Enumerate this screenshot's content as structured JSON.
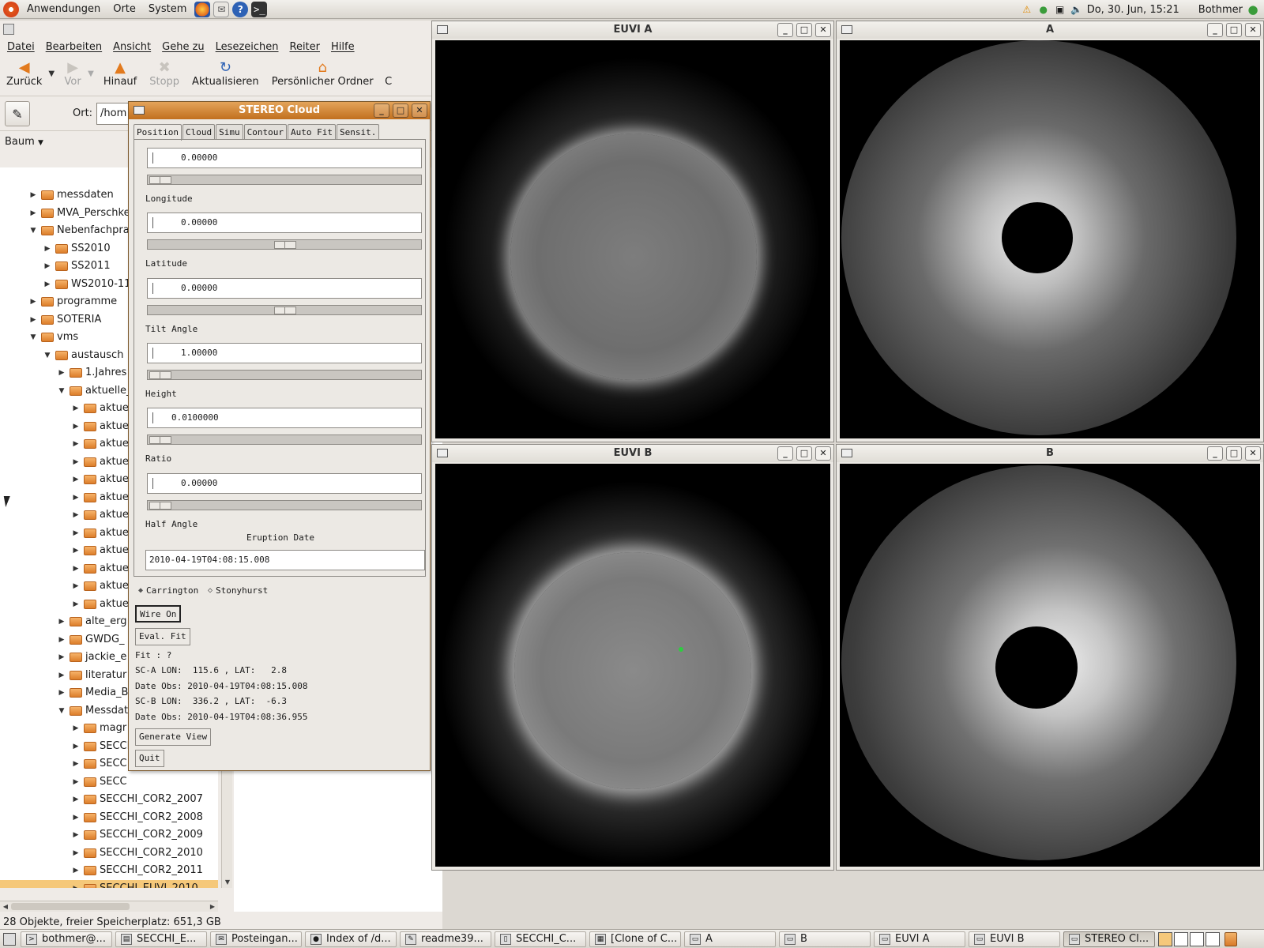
{
  "top_panel": {
    "menus": [
      "Anwendungen",
      "Orte",
      "System"
    ],
    "launchers": [
      "firefox-icon",
      "mail-icon",
      "help-icon",
      "terminal-icon"
    ],
    "clock": "Do, 30. Jun, 15:21",
    "user": "Bothmer"
  },
  "nautilus": {
    "menubar": [
      "Datei",
      "Bearbeiten",
      "Ansicht",
      "Gehe zu",
      "Lesezeichen",
      "Reiter",
      "Hilfe"
    ],
    "toolbar": {
      "back": "Zurück",
      "forward": "Vor",
      "up": "Hinauf",
      "stop": "Stopp",
      "reload": "Aktualisieren",
      "home": "Persönlicher Ordner",
      "overflow": "C"
    },
    "location_label": "Ort:",
    "location_value": "/hom",
    "sidebar_mode": "Baum",
    "tree": [
      {
        "label": "messdaten",
        "depth": 2,
        "state": "collapsed"
      },
      {
        "label": "MVA_Perschke",
        "depth": 2,
        "state": "collapsed"
      },
      {
        "label": "Nebenfachpra",
        "depth": 2,
        "state": "expanded"
      },
      {
        "label": "SS2010",
        "depth": 3,
        "state": "collapsed"
      },
      {
        "label": "SS2011",
        "depth": 3,
        "state": "collapsed"
      },
      {
        "label": "WS2010-11",
        "depth": 3,
        "state": "collapsed"
      },
      {
        "label": "programme",
        "depth": 2,
        "state": "collapsed"
      },
      {
        "label": "SOTERIA",
        "depth": 2,
        "state": "collapsed"
      },
      {
        "label": "vms",
        "depth": 2,
        "state": "expanded"
      },
      {
        "label": "austausch",
        "depth": 3,
        "state": "expanded"
      },
      {
        "label": "1.Jahres",
        "depth": 4,
        "state": "collapsed"
      },
      {
        "label": "aktuelle_",
        "depth": 4,
        "state": "expanded"
      },
      {
        "label": "aktue",
        "depth": 5,
        "state": "collapsed"
      },
      {
        "label": "aktue",
        "depth": 5,
        "state": "collapsed"
      },
      {
        "label": "aktue",
        "depth": 5,
        "state": "collapsed"
      },
      {
        "label": "aktue",
        "depth": 5,
        "state": "collapsed"
      },
      {
        "label": "aktue",
        "depth": 5,
        "state": "collapsed"
      },
      {
        "label": "aktue",
        "depth": 5,
        "state": "collapsed"
      },
      {
        "label": "aktue",
        "depth": 5,
        "state": "collapsed"
      },
      {
        "label": "aktue",
        "depth": 5,
        "state": "collapsed"
      },
      {
        "label": "aktue",
        "depth": 5,
        "state": "collapsed"
      },
      {
        "label": "aktue",
        "depth": 5,
        "state": "collapsed"
      },
      {
        "label": "aktue",
        "depth": 5,
        "state": "collapsed"
      },
      {
        "label": "aktue",
        "depth": 5,
        "state": "collapsed"
      },
      {
        "label": "alte_erg",
        "depth": 4,
        "state": "collapsed"
      },
      {
        "label": "GWDG_",
        "depth": 4,
        "state": "collapsed"
      },
      {
        "label": "jackie_e",
        "depth": 4,
        "state": "collapsed"
      },
      {
        "label": "literatur",
        "depth": 4,
        "state": "collapsed"
      },
      {
        "label": "Media_B",
        "depth": 4,
        "state": "collapsed"
      },
      {
        "label": "Messdat",
        "depth": 4,
        "state": "expanded"
      },
      {
        "label": "magr",
        "depth": 5,
        "state": "collapsed"
      },
      {
        "label": "SECCI",
        "depth": 5,
        "state": "collapsed"
      },
      {
        "label": "SECC",
        "depth": 5,
        "state": "collapsed"
      },
      {
        "label": "SECC",
        "depth": 5,
        "state": "collapsed"
      },
      {
        "label": "SECCHI_COR2_2007",
        "depth": 5,
        "state": "collapsed"
      },
      {
        "label": "SECCHI_COR2_2008",
        "depth": 5,
        "state": "collapsed"
      },
      {
        "label": "SECCHI_COR2_2009",
        "depth": 5,
        "state": "collapsed"
      },
      {
        "label": "SECCHI_COR2_2010",
        "depth": 5,
        "state": "collapsed"
      },
      {
        "label": "SECCHI_COR2_2011",
        "depth": 5,
        "state": "collapsed"
      },
      {
        "label": "SECCHI_EUVI_2010",
        "depth": 5,
        "state": "collapsed",
        "selected": true
      }
    ],
    "status": "28 Objekte, freier Speicherplatz: 651,3 GB"
  },
  "stereo_cloud": {
    "title": "STEREO Cloud",
    "tabs": [
      "Position",
      "Cloud",
      "Simu",
      "Contour",
      "Auto Fit",
      "Sensit."
    ],
    "active_tab": "Position",
    "fields": [
      {
        "label": "Longitude",
        "value": "0.00000",
        "slider_fraction": 0.0
      },
      {
        "label": "Latitude",
        "value": "0.00000",
        "slider_fraction": 0.5
      },
      {
        "label": "Tilt Angle",
        "value": "0.00000",
        "slider_fraction": 0.5
      },
      {
        "label": "Height",
        "value": "1.00000",
        "slider_fraction": 0.0
      },
      {
        "label": "Ratio",
        "value": "0.0100000",
        "slider_fraction": 0.0
      },
      {
        "label": "Half Angle",
        "value": "0.00000",
        "slider_fraction": 0.0
      }
    ],
    "eruption_date_label": "Eruption Date",
    "eruption_date": "2010-04-19T04:08:15.008",
    "coord_options": [
      "Carrington",
      "Stonyhurst"
    ],
    "wire_button": "Wire On",
    "eval_button": "Eval. Fit",
    "fit_text": "Fit : ?",
    "sc_a": "SC-A LON:  115.6 , LAT:   2.8",
    "date_a": "Date Obs: 2010-04-19T04:08:15.008",
    "sc_b": "SC-B LON:  336.2 , LAT:  -6.3",
    "date_b": "Date Obs: 2010-04-19T04:08:36.955",
    "generate_button": "Generate View",
    "quit_button": "Quit"
  },
  "image_windows": {
    "euvi_a": "EUVI A",
    "cor_a": "A",
    "euvi_b": "EUVI B",
    "cor_b": "B"
  },
  "taskbar": {
    "tasks": [
      {
        "label": "bothmer@...",
        "icon": "terminal-icon"
      },
      {
        "label": "SECCHI_E...",
        "icon": "file-manager-icon"
      },
      {
        "label": "Posteingan...",
        "icon": "mail-icon"
      },
      {
        "label": "Index of /d...",
        "icon": "firefox-icon"
      },
      {
        "label": "readme39...",
        "icon": "text-editor-icon"
      },
      {
        "label": "SECCHI_C...",
        "icon": "document-icon"
      },
      {
        "label": "[Clone of C...",
        "icon": "app-icon"
      },
      {
        "label": "A",
        "icon": "window-icon"
      },
      {
        "label": "B",
        "icon": "window-icon"
      },
      {
        "label": "EUVI A",
        "icon": "window-icon"
      },
      {
        "label": "EUVI B",
        "icon": "window-icon"
      },
      {
        "label": "STEREO Cl...",
        "icon": "window-icon",
        "active": true
      }
    ]
  }
}
